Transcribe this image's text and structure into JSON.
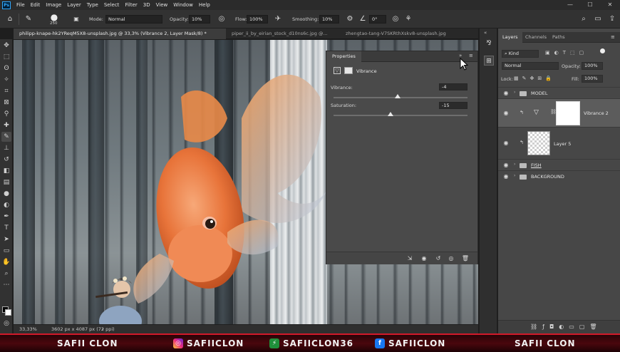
{
  "app": {
    "logo": "Ps",
    "menu": [
      "File",
      "Edit",
      "Image",
      "Layer",
      "Type",
      "Select",
      "Filter",
      "3D",
      "View",
      "Window",
      "Help"
    ],
    "window_controls": [
      "—",
      "☐",
      "✕"
    ]
  },
  "options_bar": {
    "brush_size": "250",
    "mode_label": "Mode:",
    "mode_value": "Normal",
    "opacity_label": "Opacity:",
    "opacity_value": "10%",
    "flow_label": "Flow:",
    "flow_value": "100%",
    "smoothing_label": "Smoothing:",
    "smoothing_value": "10%",
    "angle_value": "0°"
  },
  "tabs": [
    "philipp-knape-hk2YReqM5X8-unsplash.jpg @ 33,3% (Vibrance 2, Layer Mask/8) *",
    "piper_ii_by_eirian_stock_d10ns6c.jpg @...",
    "zhengtao-tang-V7SKRthXskv8-unsplash.jpg"
  ],
  "properties": {
    "tab_label": "Properties",
    "adjustment_name": "Vibrance",
    "vibrance_label": "Vibrance:",
    "vibrance_value": "-4",
    "saturation_label": "Saturation:",
    "saturation_value": "-15",
    "vibrance_level": -4,
    "saturation_level": -15
  },
  "layers_panel": {
    "tabs": [
      "Layers",
      "Channels",
      "Paths"
    ],
    "kind_label": "Kind",
    "blend_mode": "Normal",
    "opacity_label": "Opacity:",
    "opacity_value": "100%",
    "lock_label": "Lock:",
    "fill_label": "Fill:",
    "fill_value": "100%",
    "layers": [
      {
        "name": "MODEL"
      },
      {
        "name": "Vibrance 2"
      },
      {
        "name": "Layer 5"
      },
      {
        "name": "FISH"
      },
      {
        "name": "BACKGROUND"
      }
    ]
  },
  "status": {
    "zoom": "33,33%",
    "doc_info": "3602 px x 4087 px (72 ppi)"
  },
  "banner": {
    "left_name": "SAFII CLON",
    "instagram": "SAFIICLON",
    "other": "SAFIICLON36",
    "facebook": "SAFIICLON",
    "right_name": "SAFII CLON"
  },
  "colors": {
    "accent_red": "#d21a2a",
    "fish_orange": "#e8743a",
    "panel_bg": "#474747"
  }
}
